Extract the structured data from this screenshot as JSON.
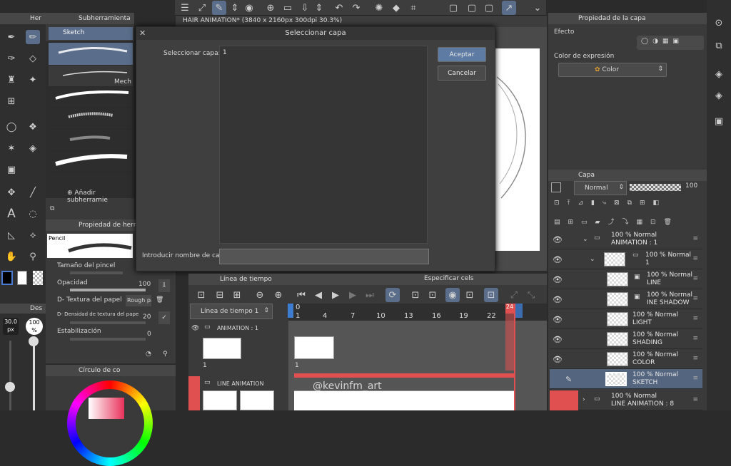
{
  "toolbar": {
    "menu_icon": "hamburger-icon",
    "tools": [
      "fit-icon",
      "pen-nav-icon",
      "select-icon",
      "camera-icon",
      "new-file-icon",
      "open-icon",
      "save-icon",
      "undo-icon",
      "redo-icon",
      "loading-icon",
      "fill-icon",
      "crop-icon",
      "clear-icon",
      "select-layer-icon"
    ]
  },
  "tool_panel": {
    "header": "Her",
    "sub_header": "Subherramienta",
    "active_sub": "Sketch",
    "brush_label": "Mech",
    "add_sub": "Añadir subherramie",
    "props_header": "Propiedad de herra",
    "brush_name": "Pencil",
    "size_label": "Tamaño del pincel",
    "opacity_label": "Opacidad",
    "opacity_value": "100",
    "texture_label": "D- Textura del papel",
    "texture_value": "Rough pa",
    "density_label": "D- Densidad de textura del pape",
    "density_value": "20",
    "stabilization_label": "Estabilización",
    "stabilization_value": "0",
    "color_circle_header": "Círculo de co",
    "size_value": "30.0",
    "size_unit": "px",
    "opacity_pct": "100",
    "opacity_pct_unit": "%",
    "size_header": "Des"
  },
  "document_tab": "HAIR ANIMATION* (3840 x 2160px 300dpi 30.3%)",
  "dialog": {
    "title": "Seleccionar capa",
    "select_label": "Seleccionar capa:",
    "list_value": "1",
    "ok": "Aceptar",
    "cancel": "Cancelar",
    "name_label": "Introducir nombre de capa:",
    "name_value": ""
  },
  "timeline": {
    "header": "Línea de tiempo",
    "specify_cels": "Especificar cels",
    "timeline_name": "Línea de tiempo 1",
    "frames": [
      "1",
      "4",
      "7",
      "10",
      "13",
      "16",
      "19",
      "22"
    ],
    "frame_start": "0",
    "frame_end": "24",
    "tracks": [
      {
        "name": "ANIMATION : 1",
        "cel": "1"
      },
      {
        "name": "LINE ANIMATION",
        "cel": ""
      }
    ],
    "watermark": "@kevinfm_art"
  },
  "properties_panel": {
    "header": "Propiedad de la capa",
    "effect_label": "Efecto",
    "expression_label": "Color de expresión",
    "expression_value": "Color"
  },
  "layer_panel": {
    "header": "Capa",
    "blend_mode": "Normal",
    "opacity": "100",
    "layers": [
      {
        "line1": "100 % Normal",
        "line2": "ANIMATION : 1",
        "kind": "folder"
      },
      {
        "line1": "100 % Normal",
        "line2": "1",
        "kind": "folder"
      },
      {
        "line1": "100 % Normal",
        "line2": "LINE",
        "kind": "raster"
      },
      {
        "line1": "100 % Normal",
        "line2": "INE SHADOW",
        "kind": "raster"
      },
      {
        "line1": "100 % Normal",
        "line2": "LIGHT",
        "kind": "raster"
      },
      {
        "line1": "100 % Normal",
        "line2": "SHADING",
        "kind": "raster"
      },
      {
        "line1": "100 % Normal",
        "line2": "COLOR",
        "kind": "raster"
      },
      {
        "line1": "100 % Normal",
        "line2": "SKETCH",
        "kind": "raster"
      },
      {
        "line1": "100 % Normal",
        "line2": "LINE ANIMATION : 8",
        "kind": "folder"
      }
    ]
  },
  "colors": {
    "accent": "#5a6d8a",
    "selected_layer": "#54657f",
    "ok_button": "#5d7ba3",
    "timeline_red": "#e05050",
    "timeline_blue": "#3d7ccf"
  }
}
